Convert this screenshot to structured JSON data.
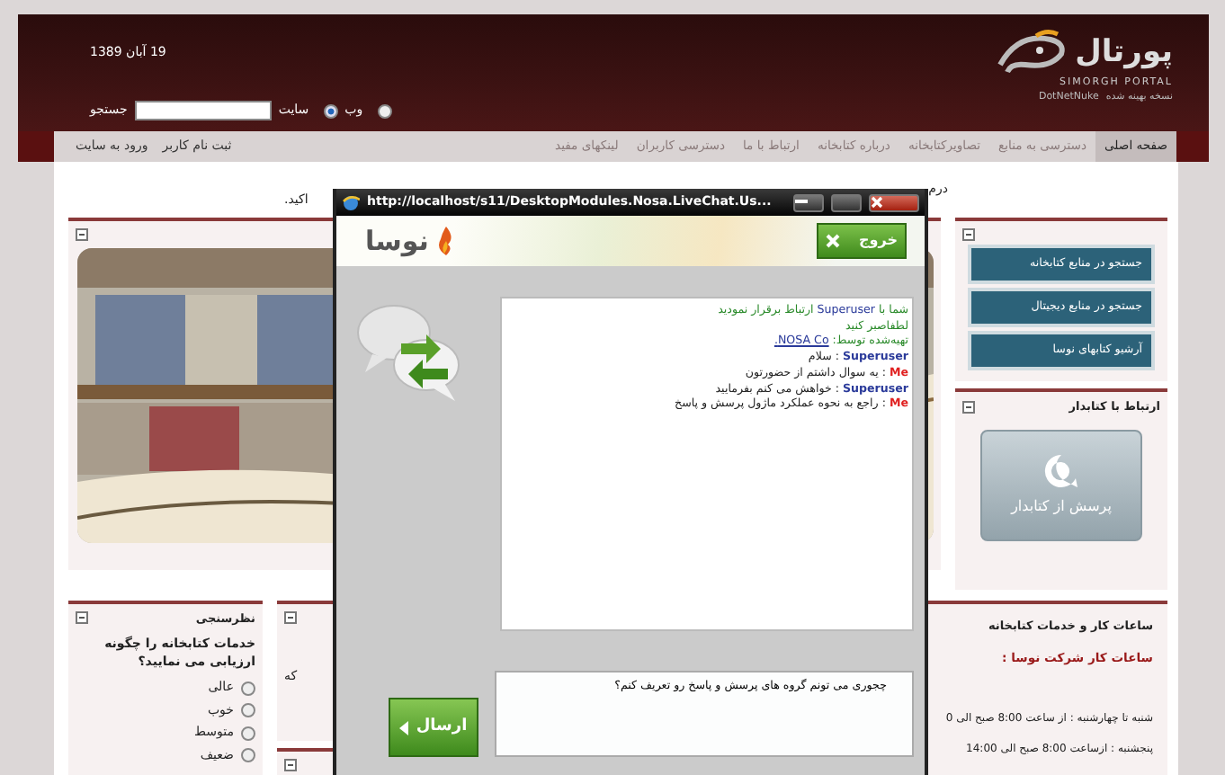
{
  "header": {
    "date": "19 آبان 1389",
    "logo": {
      "title": "پورتال",
      "subtitle": "SIMORGH PORTAL",
      "engine": "DotNetNuke",
      "edition": "نسخه بهینه شده"
    },
    "search": {
      "label": "جستجو",
      "options": [
        {
          "label": "وب",
          "selected": false
        },
        {
          "label": "سایت",
          "selected": true
        }
      ]
    }
  },
  "nav": {
    "items": [
      {
        "label": "صفحه اصلی",
        "selected": true
      },
      {
        "label": "دسترسی به منابع",
        "selected": false
      },
      {
        "label": "تصاویرکتابخانه",
        "selected": false
      },
      {
        "label": "درباره کتابخانه",
        "selected": false
      },
      {
        "label": "ارتباط با ما",
        "selected": false
      },
      {
        "label": "دسترسی کاربران",
        "selected": false
      },
      {
        "label": "لینکهای مفید",
        "selected": false
      }
    ],
    "user_links": [
      "ثبت نام کاربر",
      "ورود به سایت"
    ]
  },
  "intro_fragments": [
    "درم",
    "اکید."
  ],
  "quick_links": [
    "جستجو در منابع کتابخانه",
    "جستجو در منابع دیجیتال",
    "آرشیو کتابهای نوسا"
  ],
  "librarian": {
    "title": "ارتباط با کتابدار",
    "button": "پرسش از کتابدار"
  },
  "hours": {
    "title": "ساعات کار و خدمات کتابخانه",
    "subtitle": "ساعات کار شرکت نوسا :",
    "lines": [
      "شنبه تا چهارشنبه : از ساعت 8:00 صبح الی 0",
      "پنجشنبه : ازساعت 8:00 صبح الی 14:00"
    ]
  },
  "middle_fragment": "که",
  "poll": {
    "title": "نظرسنجی",
    "question": "خدمات کتابخانه را چگونه ارزیابی می نمایید؟",
    "options": [
      {
        "label": "عالی",
        "selected": false
      },
      {
        "label": "خوب",
        "selected": false
      },
      {
        "label": "متوسط",
        "selected": false
      },
      {
        "label": "ضعیف",
        "selected": false
      }
    ]
  },
  "chat_window": {
    "title": "http://localhost/s11/DesktopModules.Nosa.LiveChat.Us...",
    "brand": "نوسا",
    "exit_button": "خروج",
    "messages": [
      {
        "kind": "system",
        "before": "شما با",
        "name": "Superuser",
        "after": "ارتباط برقرار نمودید"
      },
      {
        "kind": "system",
        "before": "لطفاصبر کنید"
      },
      {
        "kind": "credit",
        "before": "تهیه‌شده توسط:",
        "link": "NOSA Co."
      },
      {
        "kind": "chat",
        "sender": "Superuser",
        "from_me": false,
        "text": ": سلام"
      },
      {
        "kind": "chat",
        "sender": "Me",
        "from_me": true,
        "text": ": یه سوال داشتم از حضورتون"
      },
      {
        "kind": "chat",
        "sender": "Superuser",
        "from_me": false,
        "text": ": خواهش می کنم بفرمایید"
      },
      {
        "kind": "chat",
        "sender": "Me",
        "from_me": true,
        "text": ": راجع به نحوه عملکرد ماژول پرسش و پاسخ"
      }
    ],
    "input": "چجوری می تونم گروه های پرسش و پاسخ رو تعریف کنم؟",
    "send_button": "ارسال"
  }
}
